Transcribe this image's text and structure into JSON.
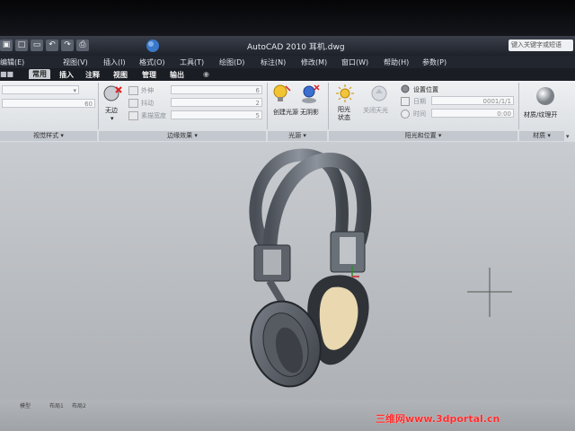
{
  "window": {
    "title": "AutoCAD 2010    耳机.dwg",
    "search_placeholder": "键入关键字或短语"
  },
  "menubar": {
    "items": [
      "编辑(E)",
      "视图(V)",
      "插入(I)",
      "格式(O)",
      "工具(T)",
      "绘图(D)",
      "标注(N)",
      "修改(M)",
      "窗口(W)",
      "帮助(H)",
      "参数(P)"
    ]
  },
  "ribbon_tabs": {
    "items": [
      "插入",
      "注释",
      "视图",
      "管理",
      "输出"
    ],
    "left_fragment": "常用"
  },
  "ribbon": {
    "visual_styles": {
      "title": "视觉样式",
      "value": "60"
    },
    "edge_effects": {
      "title": "边缘效果",
      "no_edge_label": "无边",
      "row_labels": [
        "外伸",
        "抖动",
        "素描宽度"
      ],
      "row_values": [
        "6",
        "2",
        "5"
      ]
    },
    "lights": {
      "title": "光源",
      "create_light_label": "创建光源",
      "no_shadow_label": "无阴影"
    },
    "sun_location": {
      "title": "阳光和位置",
      "sun_status_label": "阳光状态",
      "sky_label": "关闭天光",
      "set_location_label": "设置位置",
      "date_label": "日期",
      "time_label": "时间",
      "date_value": "0001/1/1",
      "time_value": "0:00"
    },
    "materials": {
      "title": "材质",
      "label": "材质/纹理开"
    }
  },
  "statusbar": {
    "tabs": [
      "模型",
      "布局1",
      "布局2"
    ]
  },
  "watermark": "三维网www.3dportal.cn"
}
